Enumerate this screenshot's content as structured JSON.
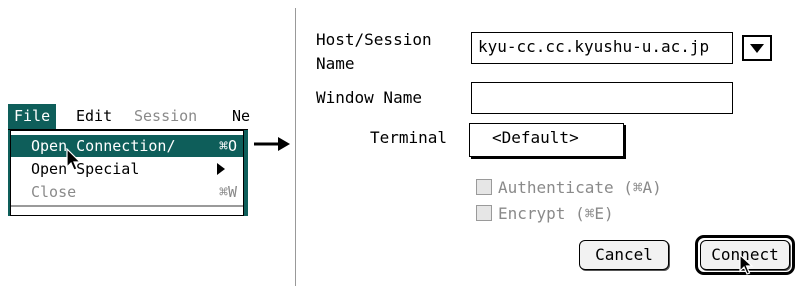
{
  "menubar": {
    "items": [
      "File",
      "Edit",
      "Session",
      "Ne"
    ]
  },
  "file_menu": {
    "items": [
      {
        "label": "Open Connection∕",
        "shortcut": "⌘O"
      },
      {
        "label": "Open Special",
        "shortcut": ""
      },
      {
        "label": "Close",
        "shortcut": "⌘W"
      }
    ]
  },
  "dialog": {
    "host_label_line1": "Host/Session",
    "host_label_line2": "Name",
    "host_value": "kyu-cc.cc.kyushu-u.ac.jp",
    "window_name_label": "Window Name",
    "window_name_value": "",
    "terminal_label": "Terminal",
    "terminal_value": "<Default>",
    "authenticate_label": "Authenticate (⌘A)",
    "encrypt_label": "Encrypt (⌘E)",
    "cancel_label": "Cancel",
    "connect_label": "Connect"
  },
  "colors": {
    "highlight": "#0e5e5a",
    "disabled": "#8a8a8a"
  }
}
